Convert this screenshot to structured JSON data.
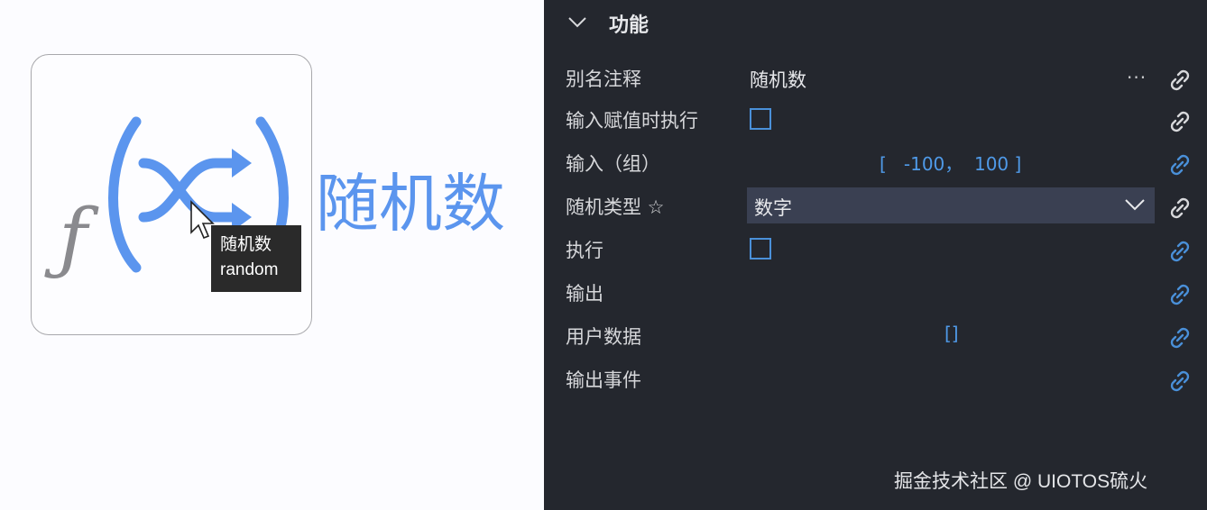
{
  "node": {
    "title": "随机数",
    "tooltip_line1": "随机数",
    "tooltip_line2": "random",
    "icon": "random-function-icon",
    "accent_color": "#5b95ee"
  },
  "panel": {
    "section_title": "功能",
    "rows": [
      {
        "label": "别名注释",
        "value": "随机数",
        "more": "...",
        "link_state": "unlinked"
      },
      {
        "label": "输入赋值时执行",
        "checked": false,
        "link_state": "unlinked"
      },
      {
        "label": "输入（组）",
        "value": "[   -100，  100 ]",
        "link_state": "linked"
      },
      {
        "label": "随机类型 ☆",
        "value": "数字",
        "link_state": "unlinked"
      },
      {
        "label": "执行",
        "checked": false,
        "link_state": "linked"
      },
      {
        "label": "输出",
        "link_state": "linked"
      },
      {
        "label": "用户数据",
        "value": "[]",
        "link_state": "linked"
      },
      {
        "label": "输出事件",
        "link_state": "linked"
      }
    ],
    "link_colors": {
      "linked": "#4a90d9",
      "unlinked": "#d8d9dc"
    }
  },
  "watermark": "掘金技术社区 @ UIOTOS硫火"
}
